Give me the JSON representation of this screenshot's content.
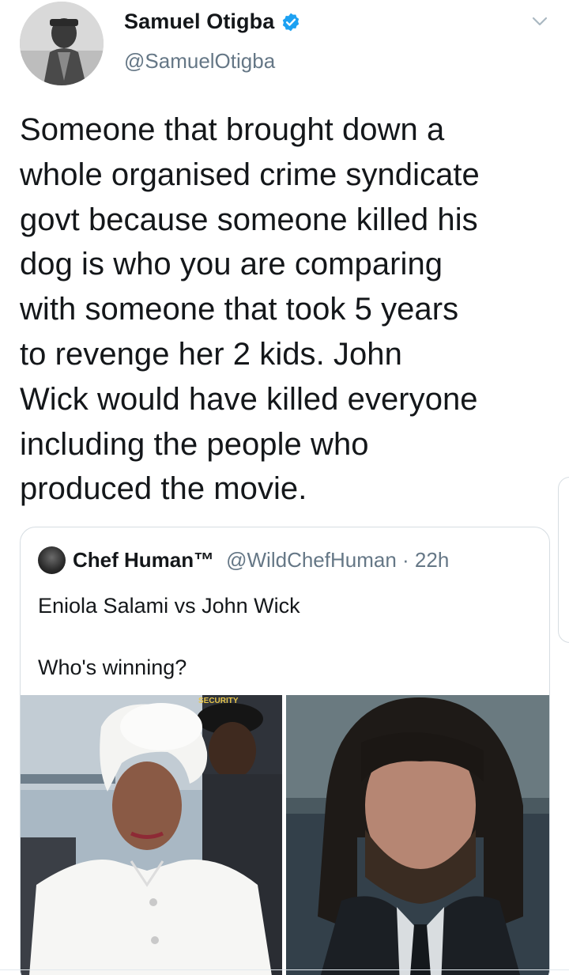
{
  "tweet": {
    "author": {
      "display_name": "Samuel Otigba",
      "handle": "@SamuelOtigba",
      "verified": true,
      "avatar_icon": "profile-photo"
    },
    "text": "Someone that brought down a\nwhole organised crime syndicate\ngovt because someone killed his\ndog is who you are comparing\nwith someone that took 5 years\nto revenge her 2 kids. John\nWick would have killed everyone\nincluding the people who\nproduced the movie.",
    "menu_icon": "chevron-down-icon"
  },
  "quote": {
    "author": {
      "display_name": "Chef Human™",
      "handle": "@WildChefHuman",
      "time": "· 22h"
    },
    "text": "Eniola Salami vs John Wick\n\nWho's winning?",
    "media": [
      {
        "kind": "photo",
        "subject": "woman-in-white-headwrap",
        "printed_text": "SECURITY"
      },
      {
        "kind": "photo",
        "subject": "man-with-long-wet-hair"
      }
    ]
  },
  "colors": {
    "text_primary": "#14171a",
    "text_secondary": "#657786",
    "verified_blue": "#1da1f2",
    "border": "#d6dde2"
  }
}
